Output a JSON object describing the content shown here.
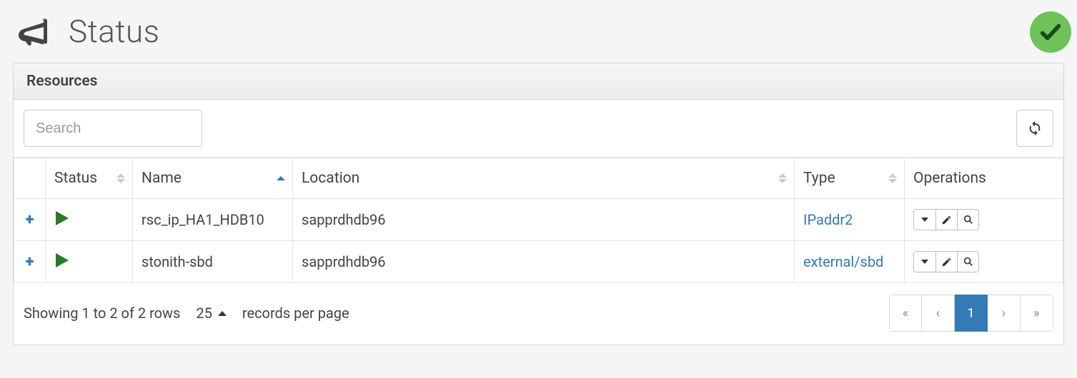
{
  "header": {
    "title": "Status"
  },
  "panel": {
    "title": "Resources",
    "search_placeholder": "Search"
  },
  "columns": {
    "status": "Status",
    "name": "Name",
    "location": "Location",
    "type": "Type",
    "operations": "Operations"
  },
  "rows": [
    {
      "name": "rsc_ip_HA1_HDB10",
      "location": "sapprdhdb96",
      "type": "IPaddr2"
    },
    {
      "name": "stonith-sbd",
      "location": "sapprdhdb96",
      "type": "external/sbd"
    }
  ],
  "footer": {
    "showing": "Showing 1 to 2 of 2 rows",
    "page_size": "25",
    "records_label": "records per page"
  },
  "pagination": {
    "first": "«",
    "prev": "‹",
    "current": "1",
    "next": "›",
    "last": "»"
  }
}
